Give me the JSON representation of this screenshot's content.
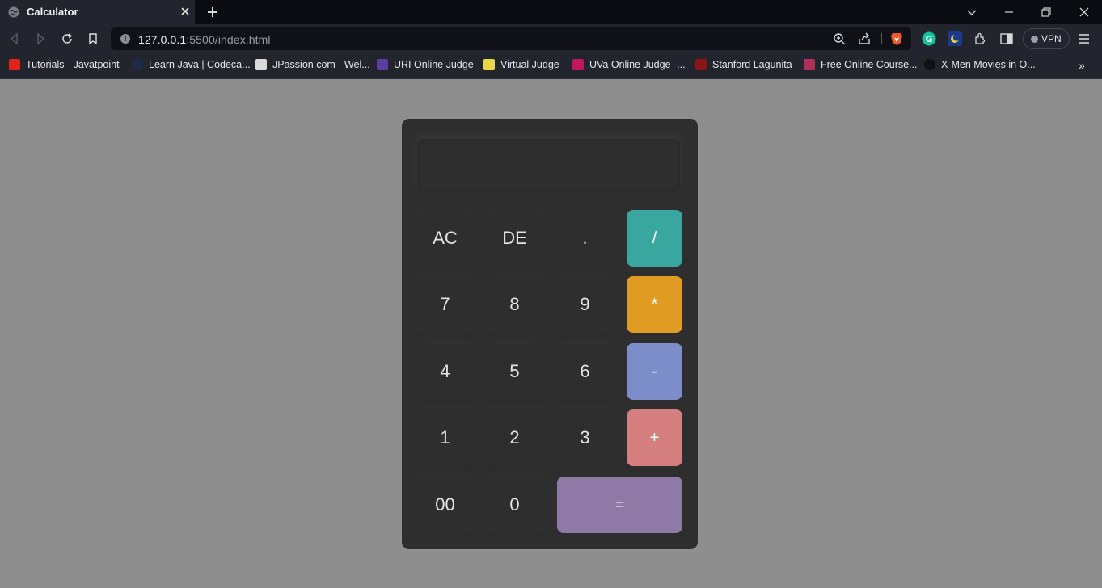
{
  "browser": {
    "tab_title": "Calculator",
    "url_host": "127.0.0.1",
    "url_rest": ":5500/index.html",
    "vpn_label": "VPN",
    "bookmarks": [
      {
        "label": "Tutorials - Javatpoint",
        "icon": "javatpoint-icon",
        "color": "#e2231a"
      },
      {
        "label": "Learn Java | Codeca...",
        "icon": "codecademy-icon",
        "color": "#1f2a44"
      },
      {
        "label": "JPassion.com - Wel...",
        "icon": "jpassion-icon",
        "color": "#d9d9d9"
      },
      {
        "label": "URI Online Judge",
        "icon": "uri-icon",
        "color": "#5a3fa0"
      },
      {
        "label": "Virtual Judge",
        "icon": "vjudge-icon",
        "color": "#e8d54a"
      },
      {
        "label": "UVa Online Judge -...",
        "icon": "uva-icon",
        "color": "#c2185b"
      },
      {
        "label": "Stanford Lagunita",
        "icon": "stanford-icon",
        "color": "#8c1515"
      },
      {
        "label": "Free Online Course...",
        "icon": "course-icon",
        "color": "#b0305a"
      },
      {
        "label": "X-Men Movies in O...",
        "icon": "xmen-icon",
        "color": "#111111"
      }
    ],
    "more_label": "»"
  },
  "calculator": {
    "display_value": "",
    "keys": [
      {
        "label": "AC"
      },
      {
        "label": "DE"
      },
      {
        "label": "."
      },
      {
        "label": "/",
        "color": "#3aa6a0"
      },
      {
        "label": "7"
      },
      {
        "label": "8"
      },
      {
        "label": "9"
      },
      {
        "label": "*",
        "color": "#e09b22"
      },
      {
        "label": "4"
      },
      {
        "label": "5"
      },
      {
        "label": "6"
      },
      {
        "label": "-",
        "color": "#7c8dc9"
      },
      {
        "label": "1"
      },
      {
        "label": "2"
      },
      {
        "label": "3"
      },
      {
        "label": "+",
        "color": "#d67f80"
      },
      {
        "label": "00"
      },
      {
        "label": "0"
      },
      {
        "label": "=",
        "color": "#8f79a6"
      }
    ]
  }
}
